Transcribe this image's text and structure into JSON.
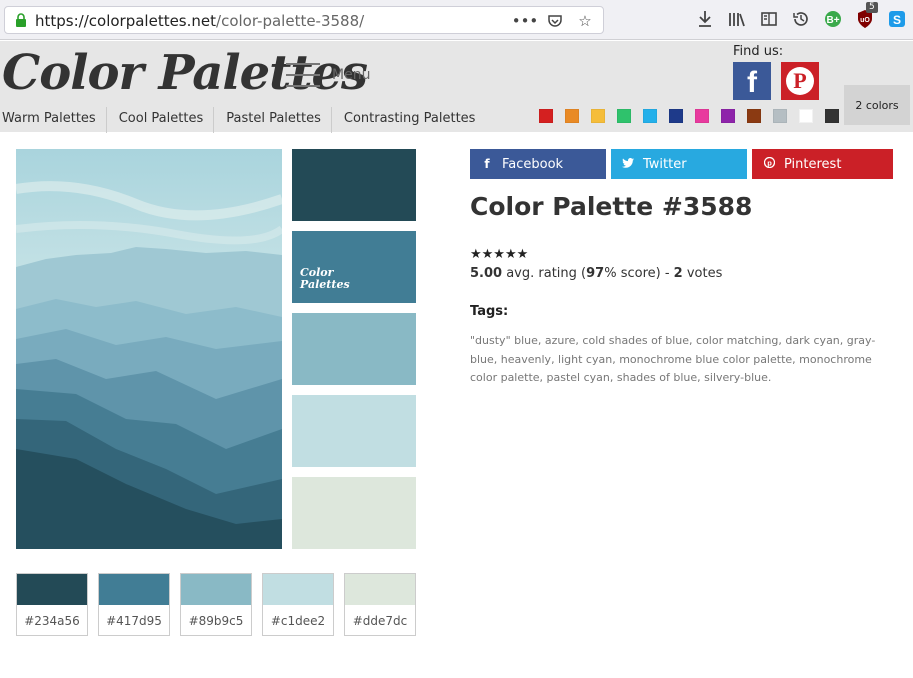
{
  "browser": {
    "url_host": "https://colorpalettes.net",
    "url_path": "/color-palette-3588/",
    "badge_count": "5"
  },
  "header": {
    "logo": "Color Palettes",
    "menu_label": "Menu",
    "find_us": "Find us:",
    "count_label": "2 colors"
  },
  "nav": {
    "items": [
      "Warm Palettes",
      "Cool Palettes",
      "Pastel Palettes",
      "Contrasting Palettes"
    ]
  },
  "color_filters": [
    "#d42020",
    "#e98a25",
    "#f5bd3a",
    "#2fc26c",
    "#24b0ea",
    "#1e3a8a",
    "#e83a9e",
    "#8e24aa",
    "#8b3a12",
    "#b5bec3",
    "#ffffff",
    "#333333"
  ],
  "palette": {
    "title": "Color Palette #3588",
    "logo_line1": "Color",
    "logo_line2": "Palettes",
    "colors": [
      {
        "hex": "#234a56",
        "label": "#234a56"
      },
      {
        "hex": "#417d95",
        "label": "#417d95"
      },
      {
        "hex": "#89b9c5",
        "label": "#89b9c5"
      },
      {
        "hex": "#c1dee2",
        "label": "#c1dee2"
      },
      {
        "hex": "#dde7dc",
        "label": "#dde7dc"
      }
    ]
  },
  "share": {
    "facebook": "Facebook",
    "twitter": "Twitter",
    "pinterest": "Pinterest"
  },
  "rating": {
    "stars": "★★★★★",
    "avg": "5.00",
    "avg_text": "avg. rating (",
    "score": "97",
    "score_text": "% score) - ",
    "votes": "2",
    "votes_text": "votes"
  },
  "tags": {
    "heading": "Tags:",
    "text": "\"dusty\" blue, azure, cold shades of blue, color matching, dark cyan, gray-blue, heavenly, light cyan, monochrome blue color palette, monochrome color palette, pastel cyan, shades of blue, silvery-blue."
  }
}
